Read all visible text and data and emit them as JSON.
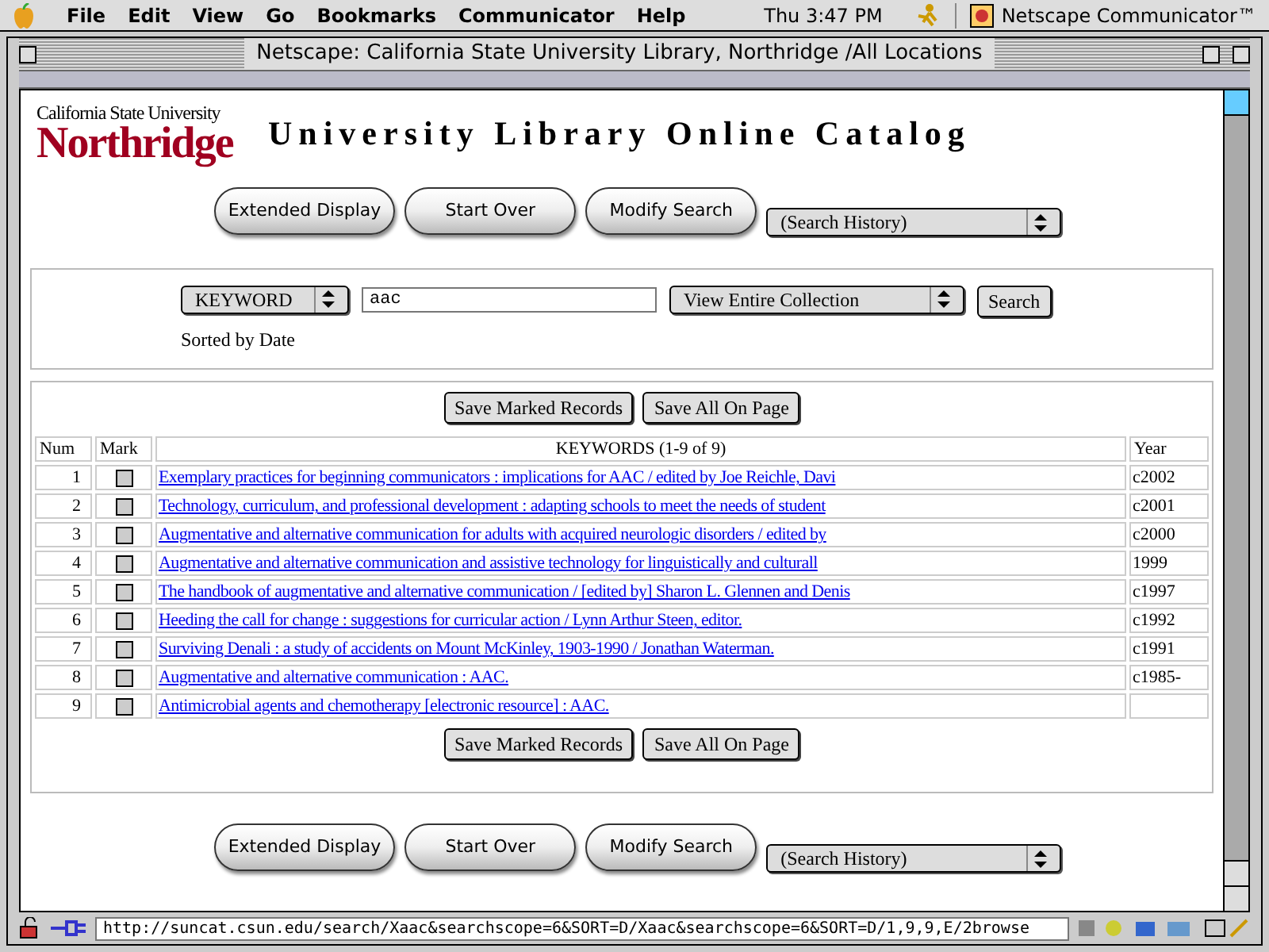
{
  "menu_bar": {
    "items": [
      "File",
      "Edit",
      "View",
      "Go",
      "Bookmarks",
      "Communicator",
      "Help"
    ],
    "clock": "Thu 3:47 PM",
    "app": "Netscape Communicator™"
  },
  "window": {
    "title": "Netscape: California State University Library, Northridge /All Locations"
  },
  "header": {
    "logo_top": "California State University",
    "logo_bottom": "Northridge",
    "title": "University Library Online Catalog"
  },
  "nav_top": {
    "buttons": [
      "Extended Display",
      "Start Over",
      "Modify Search"
    ],
    "history": "(Search History)"
  },
  "search": {
    "type": "KEYWORD",
    "query": "aac",
    "scope": "View Entire Collection",
    "button": "Search",
    "sort_note": "Sorted by Date"
  },
  "results": {
    "actions_top": [
      "Save Marked Records",
      "Save All On Page"
    ],
    "columns": [
      "Num",
      "Mark",
      "KEYWORDS (1-9 of 9)",
      "Year"
    ],
    "rows": [
      {
        "num": "1",
        "checked": false,
        "title": "Exemplary practices for beginning communicators : implications for AAC / edited by Joe Reichle, Davi",
        "year": "c2002"
      },
      {
        "num": "2",
        "checked": false,
        "title": "Technology, curriculum, and professional development : adapting schools to meet the needs of student",
        "year": "c2001"
      },
      {
        "num": "3",
        "checked": false,
        "title": "Augmentative and alternative communication for adults with acquired neurologic disorders / edited by",
        "year": "c2000"
      },
      {
        "num": "4",
        "checked": false,
        "title": "Augmentative and alternative communication and assistive technology for linguistically and culturall",
        "year": "1999"
      },
      {
        "num": "5",
        "checked": false,
        "title": "The handbook of augmentative and alternative communication / [edited by] Sharon L. Glennen and Denis",
        "year": "c1997"
      },
      {
        "num": "6",
        "checked": false,
        "title": "Heeding the call for change : suggestions for curricular action / Lynn Arthur Steen, editor.",
        "year": "c1992"
      },
      {
        "num": "7",
        "checked": false,
        "title": "Surviving Denali : a study of accidents on Mount McKinley, 1903-1990 / Jonathan Waterman.",
        "year": "c1991"
      },
      {
        "num": "8",
        "checked": false,
        "title": "Augmentative and alternative communication : AAC.",
        "year": "c1985-"
      },
      {
        "num": "9",
        "checked": false,
        "title": "Antimicrobial agents and chemotherapy [electronic resource] : AAC."
      }
    ],
    "actions_bottom": [
      "Save Marked Records",
      "Save All On Page"
    ]
  },
  "nav_bottom": {
    "buttons": [
      "Extended Display",
      "Start Over",
      "Modify Search"
    ],
    "history": "(Search History)"
  },
  "status_bar": {
    "url": "http://suncat.csun.edu/search/Xaac&searchscope=6&SORT=D/Xaac&searchscope=6&SORT=D/1,9,9,E/2browse"
  }
}
